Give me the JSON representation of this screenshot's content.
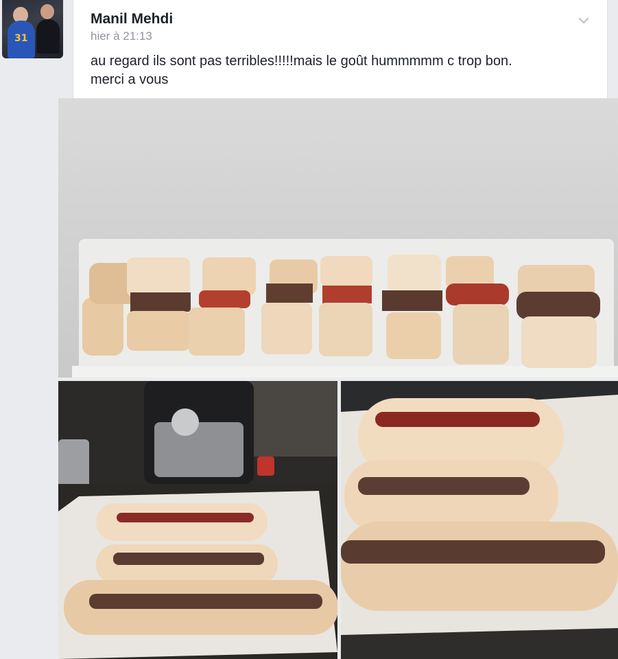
{
  "post": {
    "author_name": "Manil Mehdi",
    "timestamp": "hier à 21:13",
    "text_line1": "au regard ils sont pas terribles!!!!!mais le goût hummmmm c trop bon.",
    "text_line2": "merci a vous",
    "avatar_icon": "profile-photo",
    "menu_icon": "chevron-down-icon",
    "avatar_jersey": "31"
  },
  "photos": [
    {
      "name": "sliced-pastry-rolls-photo"
    },
    {
      "name": "baking-tray-pastries-photo"
    },
    {
      "name": "filled-pastry-logs-photo"
    }
  ],
  "colors": {
    "background": "#e9ebee",
    "card": "#ffffff",
    "text": "#1d2129",
    "meta": "#90949c"
  }
}
